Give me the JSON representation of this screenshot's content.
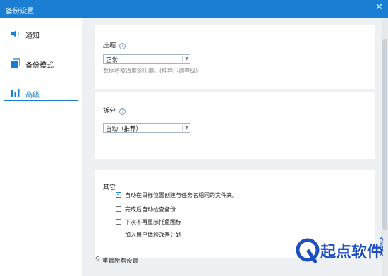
{
  "window": {
    "title": "备份设置",
    "close_glyph": "✕"
  },
  "sidebar": {
    "items": [
      {
        "label": "通知",
        "icon": "speaker-icon"
      },
      {
        "label": "备份模式",
        "icon": "copy-icon"
      },
      {
        "label": "高级",
        "icon": "bar-chart-icon",
        "active": true
      }
    ]
  },
  "compression": {
    "title": "压缩",
    "help": "?",
    "selected": "正常",
    "hint": "数据将被适度的压缩。(推荐压缩等级)"
  },
  "split": {
    "title": "拆分",
    "help": "?",
    "selected": "自动（推荐）"
  },
  "other": {
    "title": "其它",
    "options": [
      {
        "label": "自动在目标位置创建与任务名相同的文件夹。",
        "checked": true
      },
      {
        "label": "完成后自动检查备份",
        "checked": false
      },
      {
        "label": "下次不再显示托盘图标",
        "checked": false
      },
      {
        "label": "加入用户体验改善计划",
        "checked": false
      }
    ]
  },
  "reset": {
    "label": "重置所有设置"
  },
  "watermark": {
    "brand": "起点软件",
    "side": "CNCRK"
  },
  "colors": {
    "accent": "#1a7fd3",
    "panel": "#eef1f4"
  }
}
